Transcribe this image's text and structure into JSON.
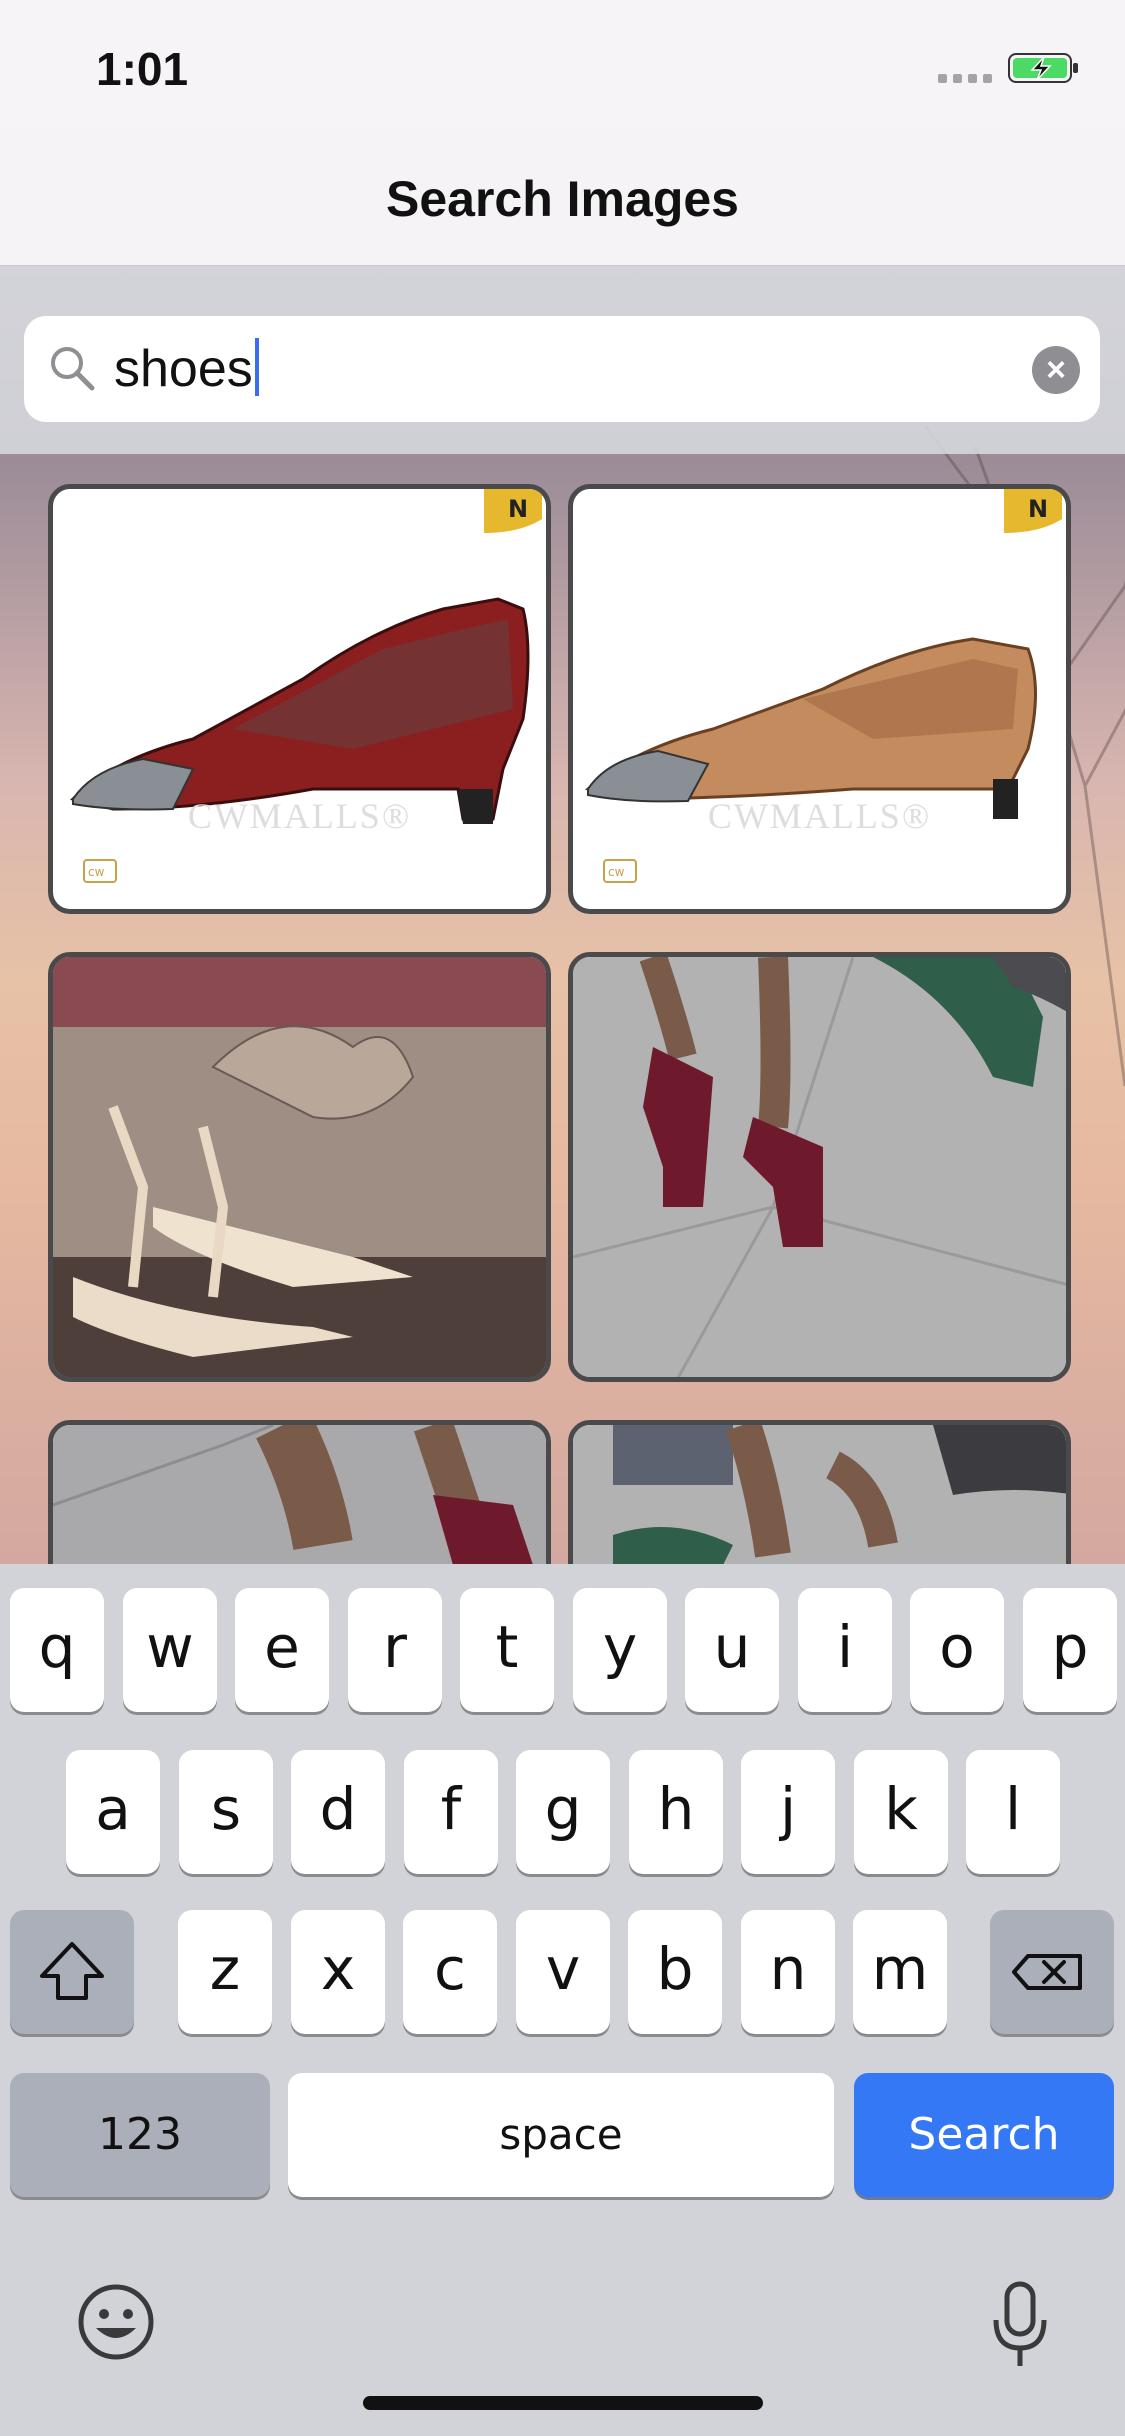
{
  "status_bar": {
    "time": "1:01"
  },
  "nav": {
    "title": "Search Images"
  },
  "search": {
    "query": "shoes",
    "clear_icon": "xmark-circle-icon",
    "search_icon": "magnifier-icon"
  },
  "results": [
    {
      "kind": "product",
      "badge": "N",
      "logo": "cw",
      "watermark": "CWMALLS®",
      "shoe_color": "#8b1e1e",
      "accent": "#5a2a2a"
    },
    {
      "kind": "product",
      "badge": "N",
      "logo": "cw",
      "watermark": "CWMALLS®",
      "shoe_color": "#c48b5e",
      "accent": "#8e5c36"
    },
    {
      "kind": "photo",
      "scene": "butterfly heels in shop window"
    },
    {
      "kind": "photo",
      "scene": "burgundy velvet block heels on pavement"
    },
    {
      "kind": "photo",
      "scene": "legs with heels (partial)"
    },
    {
      "kind": "photo",
      "scene": "green shoes (partial)"
    }
  ],
  "keyboard": {
    "row1": [
      "q",
      "w",
      "e",
      "r",
      "t",
      "y",
      "u",
      "i",
      "o",
      "p"
    ],
    "row2": [
      "a",
      "s",
      "d",
      "f",
      "g",
      "h",
      "j",
      "k",
      "l"
    ],
    "row3": [
      "z",
      "x",
      "c",
      "v",
      "b",
      "n",
      "m"
    ],
    "shift_icon": "shift-arrow-icon",
    "delete_icon": "backspace-icon",
    "numbers_label": "123",
    "space_label": "space",
    "search_label": "Search",
    "emoji_icon": "emoji-face-icon",
    "mic_icon": "microphone-icon",
    "accent": "#3478f6"
  }
}
